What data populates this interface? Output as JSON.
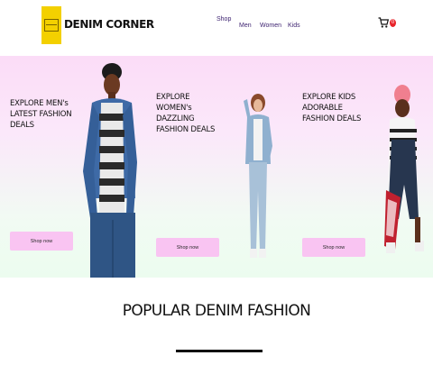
{
  "brand": {
    "name": "DENIM CORNER"
  },
  "nav": {
    "shop": "Shop",
    "men": "Men",
    "women": "Women",
    "kids": "Kids"
  },
  "cart": {
    "count": "0"
  },
  "hero": {
    "columns": [
      {
        "title": "EXPLORE MEN's LATEST FASHION DEALS",
        "button": "Shop now"
      },
      {
        "title": "EXPLORE WOMEN's DAZZLING FASHION DEALS",
        "button": "Shop now"
      },
      {
        "title": "EXPLORE KIDS ADORABLE FASHION DEALS",
        "button": "Shop now"
      }
    ]
  },
  "section": {
    "heading": "POPULAR DENIM FASHION"
  },
  "colors": {
    "accent_pink": "#f9c4f2",
    "nav_purple": "#3a1f6e",
    "logo_yellow": "#f3d000",
    "badge_red": "#e8242a"
  }
}
